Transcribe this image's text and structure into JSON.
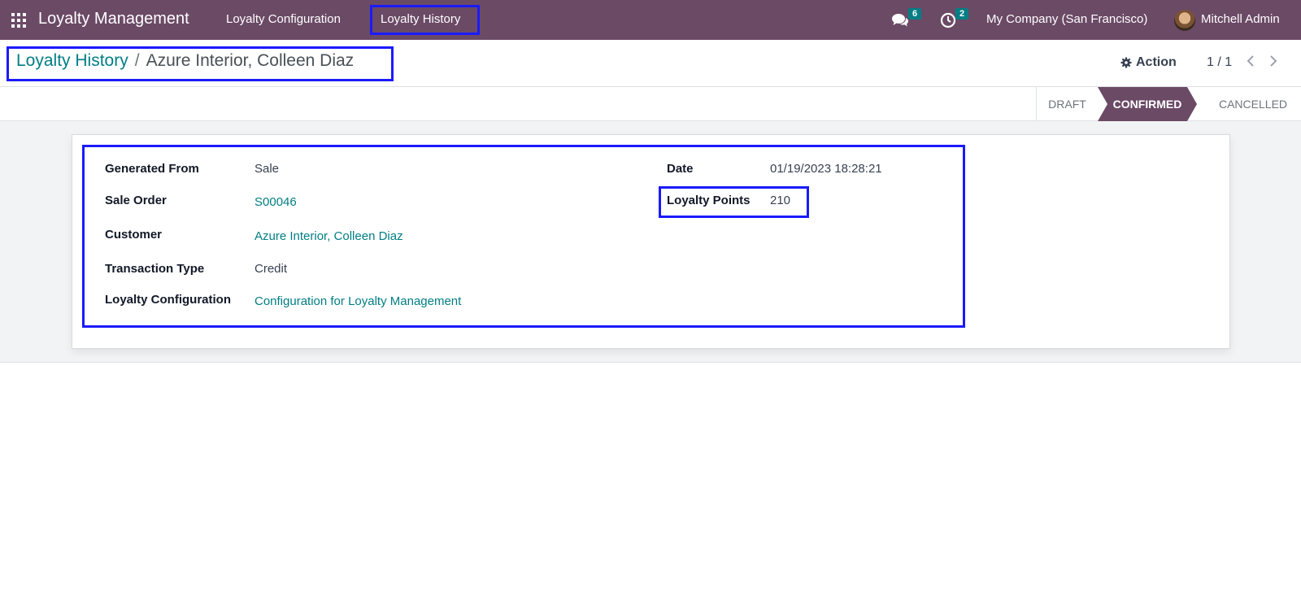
{
  "navbar": {
    "app_name": "Loyalty Management",
    "menu": [
      "Loyalty Configuration",
      "Loyalty History"
    ],
    "messages_count": "6",
    "activities_count": "2",
    "company": "My Company (San Francisco)",
    "user": "Mitchell Admin"
  },
  "breadcrumb": {
    "parent": "Loyalty History",
    "separator": "/",
    "current": "Azure Interior, Colleen Diaz"
  },
  "control": {
    "action_label": "Action",
    "pager": "1 / 1"
  },
  "statusbar": {
    "states": [
      "DRAFT",
      "CONFIRMED",
      "CANCELLED"
    ],
    "active": "CONFIRMED"
  },
  "form": {
    "generated_from": {
      "label": "Generated From",
      "value": "Sale"
    },
    "sale_order": {
      "label": "Sale Order",
      "value": "S00046"
    },
    "customer": {
      "label": "Customer",
      "value": "Azure Interior, Colleen Diaz"
    },
    "transaction_type": {
      "label": "Transaction Type",
      "value": "Credit"
    },
    "loyalty_configuration": {
      "label": "Loyalty Configuration",
      "value": "Configuration for Loyalty Management"
    },
    "date": {
      "label": "Date",
      "value": "01/19/2023 18:28:21"
    },
    "loyalty_points": {
      "label": "Loyalty Points",
      "value": "210"
    }
  },
  "colors": {
    "navbar": "#6b4a66",
    "link": "#017e84",
    "highlight": "#1a1aff"
  }
}
